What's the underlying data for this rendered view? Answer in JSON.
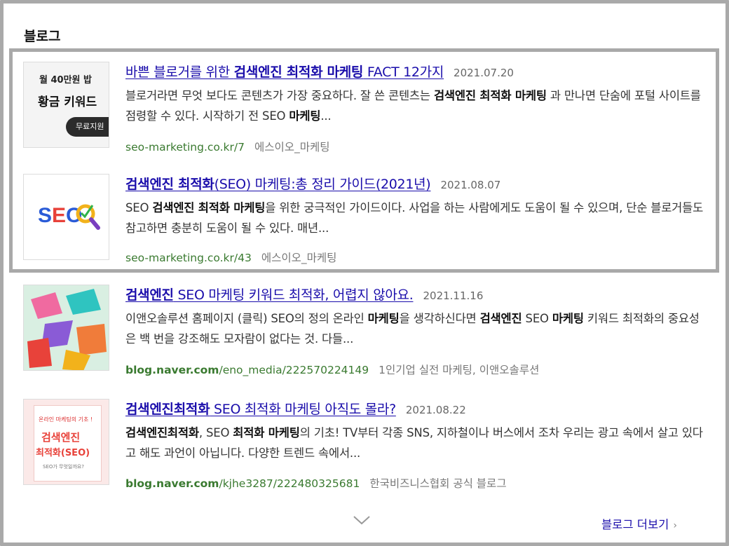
{
  "section": {
    "title": "블로그"
  },
  "results": [
    {
      "title_pre": "바쁜 블로거를 위한 ",
      "title_bold": "검색엔진 최적화 마케팅",
      "title_post": " FACT 12가지",
      "date": "2021.07.20",
      "desc_parts": [
        {
          "t": "블로거라면 무엇 보다도 콘텐츠가 가장 중요하다. 잘 쓴 콘텐츠는 ",
          "b": false
        },
        {
          "t": "검색엔진 최적화 마케팅",
          "b": true
        },
        {
          "t": " 과 만나면 단숨에 포털 사이트를 점령할 수 있다. 시작하기 전 SEO ",
          "b": false
        },
        {
          "t": "마케팅",
          "b": true
        },
        {
          "t": "...",
          "b": false
        }
      ],
      "url_bold": "",
      "url": "seo-marketing.co.kr/7",
      "author": "에스이오_마케팅",
      "thumb": {
        "line1": "월 40만원 밥",
        "line2": "황금 키워드",
        "button": "무료지원"
      }
    },
    {
      "title_pre": "",
      "title_bold": "검색엔진 최적화",
      "title_post": "(SEO) 마케팅:총 정리 가이드(2021년)",
      "date": "2021.08.07",
      "desc_parts": [
        {
          "t": "SEO ",
          "b": false
        },
        {
          "t": "검색엔진 최적화 마케팅",
          "b": true
        },
        {
          "t": "을 위한 궁극적인 가이드이다. 사업을 하는 사람에게도 도움이 될 수 있으며, 단순 블로거들도 참고하면 충분히 도움이 될 수 있다. 매년...",
          "b": false
        }
      ],
      "url_bold": "",
      "url": "seo-marketing.co.kr/43",
      "author": "에스이오_마케팅",
      "thumb": {
        "logo": "SEO"
      }
    },
    {
      "title_pre": "",
      "title_bold": "검색엔진",
      "title_post": " SEO 마케팅 키워드 최적화, 어렵지 않아요.",
      "date": "2021.11.16",
      "desc_parts": [
        {
          "t": "이앤오솔루션 홈페이지 (클릭) SEO의 정의 온라인 ",
          "b": false
        },
        {
          "t": "마케팅",
          "b": true
        },
        {
          "t": "을 생각하신다면 ",
          "b": false
        },
        {
          "t": "검색엔진",
          "b": true
        },
        {
          "t": " SEO ",
          "b": false
        },
        {
          "t": "마케팅",
          "b": true
        },
        {
          "t": " 키워드 최적화의 중요성은 백 번을 강조해도 모자람이 없다는 것. 다들...",
          "b": false
        }
      ],
      "url_bold": "blog.naver.com",
      "url": "/eno_media/222570224149",
      "author": "1인기업 실전 마케팅, 이앤오솔루션",
      "thumb": {}
    },
    {
      "title_pre": "",
      "title_bold": "검색엔진최적화",
      "title_post": " SEO 최적화 마케팅 아직도 몰라?",
      "date": "2021.08.22",
      "desc_parts": [
        {
          "t": "검색엔진최적화",
          "b": true
        },
        {
          "t": ", SEO ",
          "b": false
        },
        {
          "t": "최적화 마케팅",
          "b": true
        },
        {
          "t": "의 기초! TV부터 각종 SNS, 지하철이나 버스에서 조차 우리는 광고 속에서 살고 있다고 해도 과언이 아닙니다. 다양한 트렌드 속에서...",
          "b": false
        }
      ],
      "url_bold": "blog.naver.com",
      "url": "/kjhe3287/222480325681",
      "author": "한국비즈니스협회 공식 블로그",
      "thumb": {
        "caption": "온라인 마케팅의 기초 !",
        "line1": "검색엔진",
        "line2": "최적화(SEO)",
        "sub": "SEO가 무엇일까요?"
      }
    }
  ],
  "footer": {
    "more": "블로그 더보기",
    "more_arrow": "›"
  },
  "colors": {
    "link": "#1a0dab",
    "url": "#3a7a30",
    "frame": "#a9a9a9"
  }
}
